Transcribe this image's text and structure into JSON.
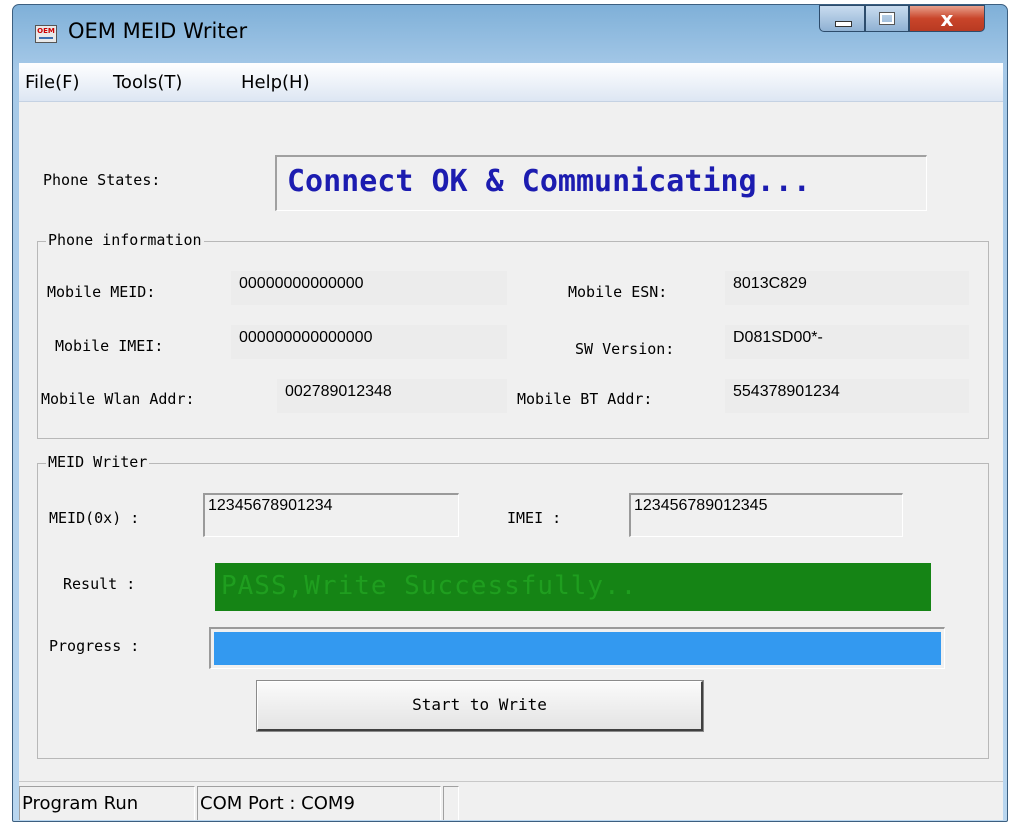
{
  "window": {
    "title": "OEM MEID Writer",
    "icon_text": "OEM",
    "close_glyph": "x"
  },
  "menu": [
    "File(F)",
    "Tools(T)",
    "Help(H)"
  ],
  "phone_states": {
    "label": "Phone States:",
    "value": "Connect OK & Communicating..."
  },
  "phone_info": {
    "group_title": "Phone information",
    "mobile_meid": {
      "label": "Mobile MEID:",
      "value": "00000000000000"
    },
    "mobile_esn": {
      "label": "Mobile ESN:",
      "value": "8013C829"
    },
    "mobile_imei": {
      "label": "Mobile IMEI:",
      "value": "000000000000000"
    },
    "sw_version": {
      "label": "SW Version:",
      "value": "D081SD00*-"
    },
    "wlan_addr": {
      "label": "Mobile Wlan Addr:",
      "value": "002789012348"
    },
    "bt_addr": {
      "label": "Mobile BT Addr:",
      "value": "554378901234"
    }
  },
  "meid_writer": {
    "group_title": "MEID Writer",
    "meid_label": "MEID(0x) :",
    "meid_value": "12345678901234",
    "imei_label": "IMEI :",
    "imei_value": "123456789012345",
    "result_label": "Result :",
    "result_text": "PASS,Write Successfully..",
    "progress_label": "Progress :",
    "progress_fraction": 1.0,
    "start_button": "Start to Write"
  },
  "status_bar": {
    "pane1": "Program Run",
    "pane2": "COM Port : COM9",
    "pane3": ""
  },
  "colors": {
    "state_text": "#1c1cb0",
    "result_bg": "#158415",
    "result_text": "#1f9e1f",
    "progress_fill": "#3399f0"
  }
}
